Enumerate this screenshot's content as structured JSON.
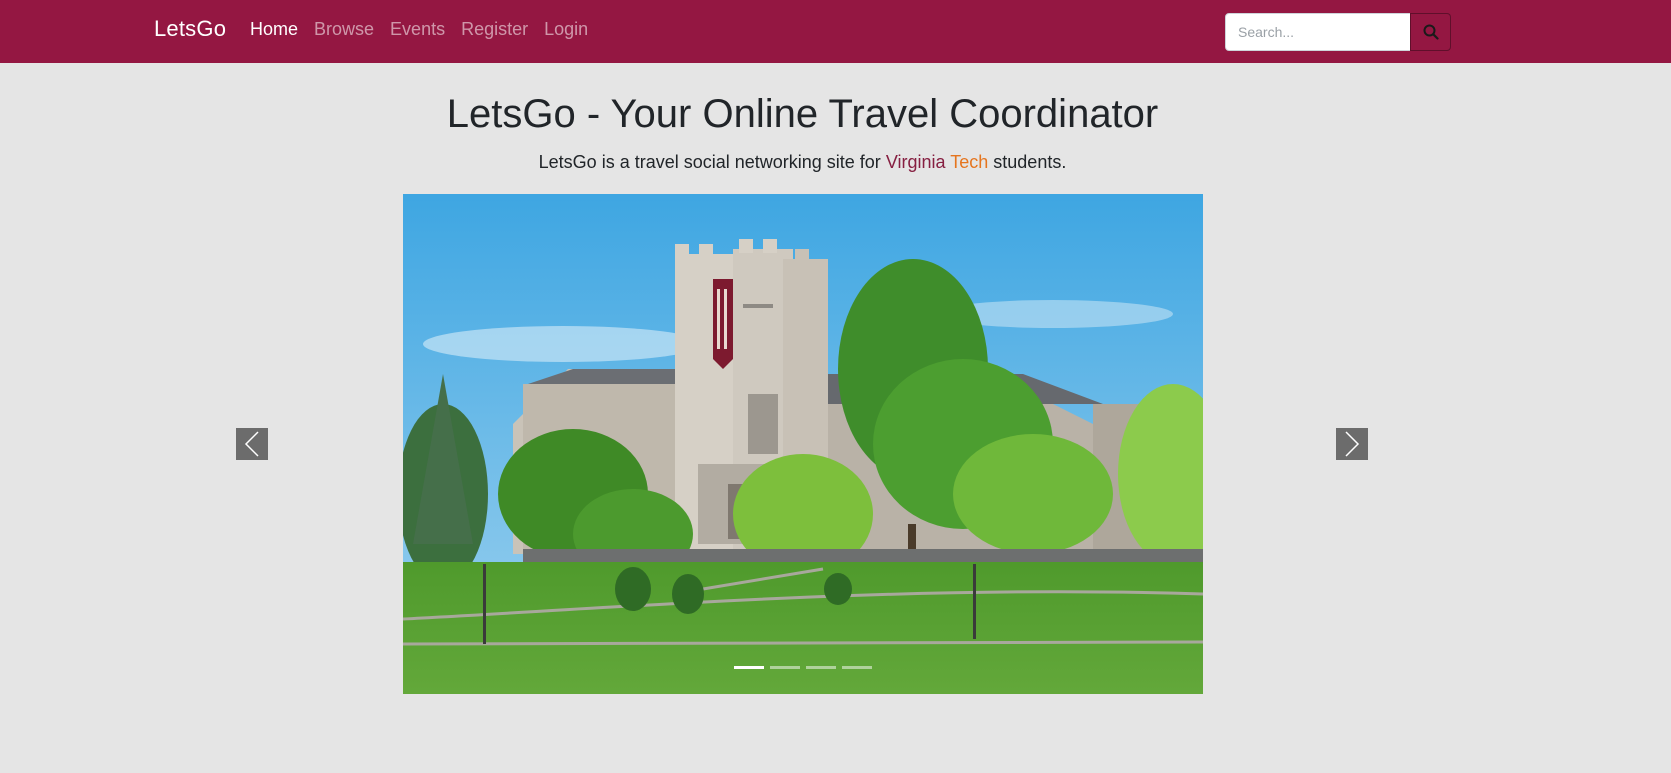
{
  "navbar": {
    "brand": "LetsGo",
    "links": [
      {
        "label": "Home",
        "active": true
      },
      {
        "label": "Browse",
        "active": false
      },
      {
        "label": "Events",
        "active": false
      },
      {
        "label": "Register",
        "active": false
      },
      {
        "label": "Login",
        "active": false
      }
    ],
    "search": {
      "placeholder": "Search...",
      "value": "",
      "icon": "search-icon"
    },
    "color": "#941742"
  },
  "main": {
    "title": "LetsGo - Your Online Travel Coordinator",
    "tagline": {
      "prefix": "LetsGo is a travel social networking site for",
      "virginia": "Virginia",
      "tech": "Tech",
      "suffix": "students.",
      "virginia_color": "#861f41",
      "tech_color": "#e5751f"
    }
  },
  "carousel": {
    "slide_count": 4,
    "active_index": 0,
    "prev_icon": "chevron-left-icon",
    "next_icon": "chevron-right-icon"
  }
}
